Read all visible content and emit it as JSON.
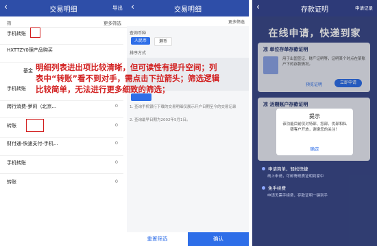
{
  "panel1": {
    "title": "交易明细",
    "action": "导出",
    "filter_left": "筛",
    "filter_right": "更多筛选",
    "rows": [
      {
        "label": "手机转账",
        "value": ""
      },
      {
        "label": "HXTTZY0理产品购买",
        "value": ""
      },
      {
        "label": "基金",
        "value": ""
      },
      {
        "label": "手机转账",
        "value": ""
      },
      {
        "label": "跨行消费-萝莉（北京...",
        "value": "0"
      },
      {
        "label": "转账",
        "value": "0"
      },
      {
        "label": "财付通-快速支付-手机...",
        "value": "0"
      },
      {
        "label": "手机转账",
        "value": "0"
      },
      {
        "label": "转账",
        "value": "0"
      }
    ]
  },
  "panel2": {
    "title": "交易明细",
    "action": "更多筛选",
    "sec1": "查询币种",
    "chip_on": "人民币",
    "chip_off": "港币",
    "sec2": "排序方式",
    "note1": "1. 查询手机银行下载的交易明细仅展示开户日期至今的交易记录",
    "note2": "2. 查询最早日期为2002年5月1日。",
    "reset": "重置筛选",
    "confirm": "确认"
  },
  "panel3": {
    "title": "存款证明",
    "action": "申请记录",
    "slogan": "在线申请，快递到家",
    "card1_title": "凉 单位存单存款证明",
    "card1_desc": "用于出国签证、财产证明等，证明某个时点在某账户下的存款情况。",
    "card1_btn1": "预览证明",
    "card1_btn2": "立即申请",
    "card2_title": "凉 活期账户存款证明",
    "dialog_title": "提示",
    "dialog_msg": "该功能目前仅对特部、您部、优部和私银客户开放，谢谢您的关注！",
    "dialog_btn": "确定",
    "feat1": "申请简单，轻松快捷",
    "feat1_desc": "线上申请，可邮寄纸质证明到家中",
    "feat2": "免手续费",
    "feat2_desc": "申请无需手续费，存款证明一键到手"
  },
  "overlay_note": "明细列表进出项比较清晰，但可读性有提升空间；列表中“转账”看不到对手，需点击下拉箭头；筛选逻辑比较简单，无法进行更多细致的筛选；"
}
